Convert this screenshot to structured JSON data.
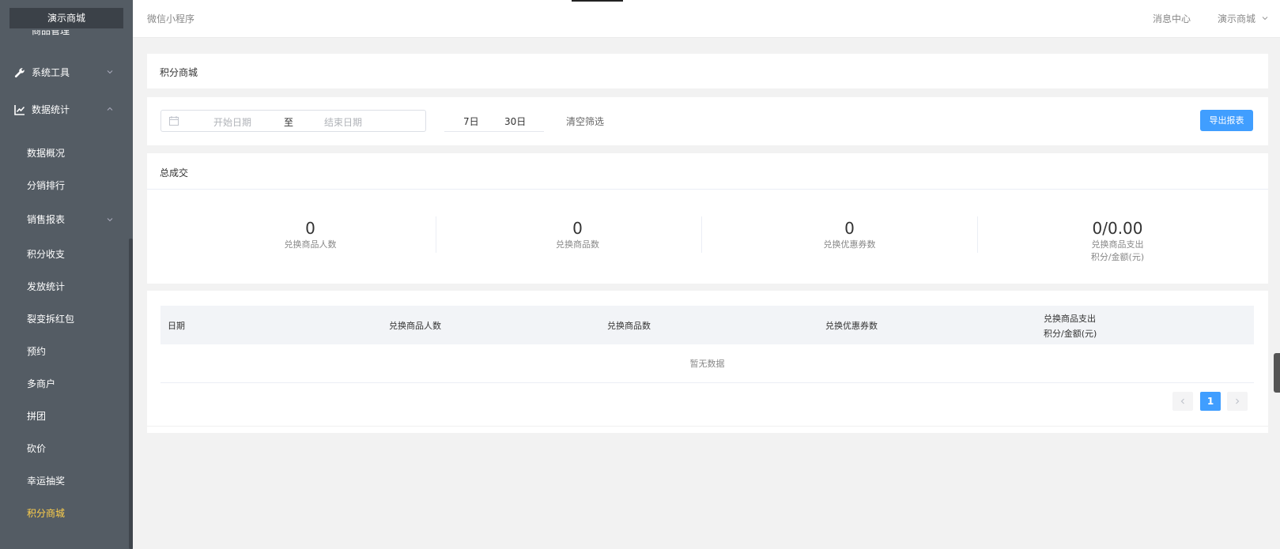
{
  "sidebar": {
    "brand": "演示商城",
    "partial_item": "商品管理",
    "menus": [
      {
        "label": "系统工具",
        "icon": "wrench-icon"
      },
      {
        "label": "数据统计",
        "icon": "line-chart-icon"
      }
    ],
    "sub_items": [
      {
        "label": "数据概况"
      },
      {
        "label": "分销排行"
      },
      {
        "label": "销售报表"
      },
      {
        "label": "积分收支"
      },
      {
        "label": "发放统计"
      },
      {
        "label": "裂变拆红包"
      },
      {
        "label": "预约"
      },
      {
        "label": "多商户"
      },
      {
        "label": "拼团"
      },
      {
        "label": "砍价"
      },
      {
        "label": "幸运抽奖"
      },
      {
        "label": "积分商城"
      }
    ],
    "active_item": "积分商城",
    "active_color": "#ffd04b"
  },
  "topbar": {
    "title": "微信小程序",
    "message_center": "消息中心",
    "user": "演示商城"
  },
  "page": {
    "title": "积分商城"
  },
  "filter": {
    "start_placeholder": "开始日期",
    "separator": "至",
    "end_placeholder": "结束日期",
    "quick_7": "7日",
    "quick_30": "30日",
    "clear": "清空筛选",
    "export": "导出报表"
  },
  "stats": {
    "title": "总成交",
    "items": [
      {
        "value": "0",
        "label": "兑换商品人数"
      },
      {
        "value": "0",
        "label": "兑换商品数"
      },
      {
        "value": "0",
        "label": "兑换优惠券数"
      },
      {
        "value": "0/0.00",
        "label": "兑换商品支出",
        "label2": "积分/金额(元)"
      }
    ]
  },
  "table": {
    "columns": [
      "日期",
      "兑换商品人数",
      "兑换商品数",
      "兑换优惠券数",
      "兑换商品支出",
      "积分/金额(元)"
    ],
    "empty_text": "暂无数据",
    "current_page": "1"
  },
  "colors": {
    "sidebar_bg": "#545c64",
    "accent": "#409eff"
  }
}
